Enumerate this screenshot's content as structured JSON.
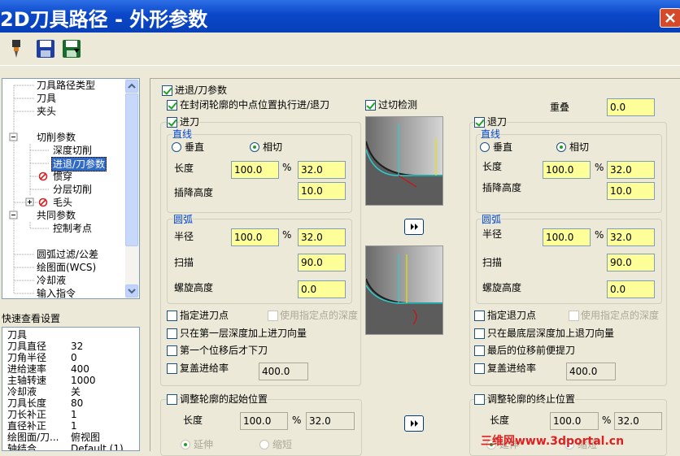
{
  "window": {
    "title": "2D刀具路径 - 外形参数"
  },
  "toolbar": {
    "icons": [
      "tool-icon",
      "save-icon",
      "save-as-icon"
    ]
  },
  "tree": {
    "items": [
      {
        "label": "刀具路径类型"
      },
      {
        "label": "刀具"
      },
      {
        "label": "夹头"
      },
      {
        "label": "切削参数"
      },
      {
        "label": "深度切削"
      },
      {
        "label": "进退/刀参数"
      },
      {
        "label": "惯穿"
      },
      {
        "label": "分层切削"
      },
      {
        "label": "毛头"
      },
      {
        "label": "共同参数"
      },
      {
        "label": "控制考点"
      },
      {
        "label": "圆弧过滤/公差"
      },
      {
        "label": "绘图面(WCS)"
      },
      {
        "label": "冷却液"
      },
      {
        "label": "输入指令"
      }
    ]
  },
  "quickview": {
    "title": "快速查看设置",
    "rows": [
      {
        "k": "刀具",
        "v": ""
      },
      {
        "k": "刀具直径",
        "v": "32"
      },
      {
        "k": "刀角半径",
        "v": "0"
      },
      {
        "k": "进给速率",
        "v": "400"
      },
      {
        "k": "主轴转速",
        "v": "1000"
      },
      {
        "k": "冷却液",
        "v": "关"
      },
      {
        "k": "刀具长度",
        "v": "80"
      },
      {
        "k": "刀长补正",
        "v": "1"
      },
      {
        "k": "直径补正",
        "v": "1"
      },
      {
        "k": "绘图面/刀...",
        "v": "俯视图"
      },
      {
        "k": "轴结合",
        "v": "Default (1)"
      }
    ]
  },
  "main": {
    "entry_exit_label": "进退/刀参数",
    "midpoint_label": "在封闭轮廓的中点位置执行进/退刀",
    "overcut_label": "过切检测",
    "overlap_label": "重叠",
    "overlap_value": "0.0",
    "entry": {
      "title": "进刀",
      "line_title": "直线",
      "perp_label": "垂直",
      "tangent_label": "相切",
      "length_label": "长度",
      "length_pct": "100.0",
      "length_val": "32.0",
      "ramp_label": "插降高度",
      "ramp_val": "10.0",
      "arc_title": "圆弧",
      "radius_label": "半径",
      "radius_pct": "100.0",
      "radius_val": "32.0",
      "sweep_label": "扫描",
      "sweep_val": "90.0",
      "helix_label": "螺旋高度",
      "helix_val": "0.0",
      "point_label": "指定进刀点",
      "use_point_label": "使用指定点的深度",
      "first_depth_label": "只在第一层深度加上进刀向量",
      "first_move_label": "第一个位移后才下刀",
      "feed_label": "复盖进给率",
      "feed_val": "400.0"
    },
    "exit": {
      "title": "退刀",
      "line_title": "直线",
      "perp_label": "垂直",
      "tangent_label": "相切",
      "length_label": "长度",
      "length_pct": "100.0",
      "length_val": "32.0",
      "ramp_label": "插降高度",
      "ramp_val": "10.0",
      "arc_title": "圆弧",
      "radius_label": "半径",
      "radius_pct": "100.0",
      "radius_val": "32.0",
      "sweep_label": "扫描",
      "sweep_val": "90.0",
      "helix_label": "螺旋高度",
      "helix_val": "0.0",
      "point_label": "指定退刀点",
      "use_point_label": "使用指定点的深度",
      "last_depth_label": "只在最底层深度加上退刀向量",
      "last_move_label": "最后的位移前便提刀",
      "feed_label": "复盖进给率",
      "feed_val": "400.0"
    },
    "adjust_start": {
      "title": "调整轮廓的起始位置",
      "length_label": "长度",
      "pct": "100.0",
      "val": "32.0",
      "extend_label": "延伸",
      "shorten_label": "缩短"
    },
    "adjust_end": {
      "title": "调整轮廓的终止位置",
      "length_label": "长度",
      "pct": "100.0",
      "val": "32.0",
      "extend_label": "延伸",
      "shorten_label": "缩短"
    },
    "percent": "%",
    "watermark": "三维网www.3dportal.cn"
  },
  "colors": {
    "titlebar": "#0a47c9",
    "input_bg": "#ffff99",
    "selected": "#316ac5",
    "heading_blue": "#0046d5"
  }
}
